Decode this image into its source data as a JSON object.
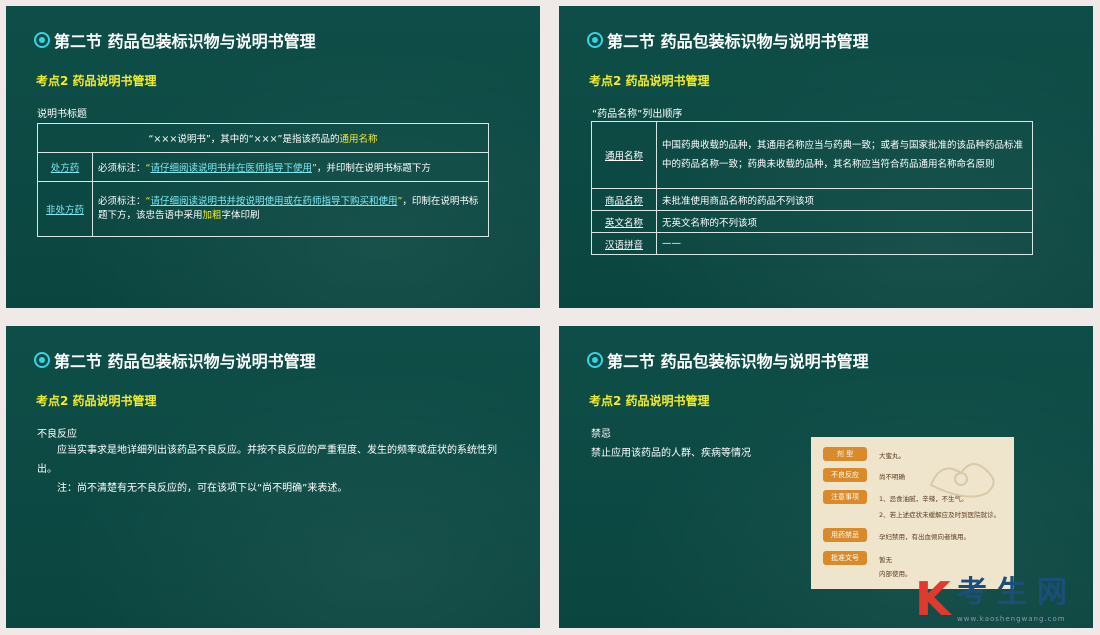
{
  "common": {
    "section_title": "第二节  药品包装标识物与说明书管理",
    "kaodian": "考点2  药品说明书管理"
  },
  "slide1": {
    "subtitle": "说明书标题",
    "header_pre": "“×××说明书”，其中的“×××”是指该药品的",
    "header_highlight": "通用名称",
    "rows": [
      {
        "label": "处方药",
        "pre": "必须标注：",
        "quote_open": "“",
        "link": "请仔细阅读说明书并在医师指导下使用",
        "quote_close": "”",
        "post": "，并印制在说明书标题下方"
      },
      {
        "label": "非处方药",
        "pre": "必须标注：",
        "quote_open": "“",
        "link": "请仔细阅读说明书并按说明使用或在药师指导下购买和使用",
        "quote_close": "”",
        "post": "，印制在说明书标题下方，该忠告语中采用",
        "bold": "加粗",
        "post2": "字体印刷"
      }
    ]
  },
  "slide2": {
    "subtitle": "“药品名称”列出顺序",
    "rows": [
      {
        "label": "通用名称",
        "text": "中国药典收载的品种，其通用名称应当与药典一致；或者与国家批准的该品种药品标准中的药品名称一致；药典未收载的品种，其名称应当符合药品通用名称命名原则"
      },
      {
        "label": "商品名称",
        "text": "未批准使用商品名称的药品不列该项"
      },
      {
        "label": "英文名称",
        "text": "无英文名称的不列该项"
      },
      {
        "label": "汉语拼音",
        "text": "——"
      }
    ]
  },
  "slide3": {
    "subtitle": "不良反应",
    "para1": "应当实事求是地详细列出该药品不良反应。并按不良反应的严重程度、发生的频率或症状的系统性列出。",
    "para2": "注：尚不清楚有无不良反应的，可在该项下以“尚不明确”来表述。"
  },
  "slide4": {
    "subtitle": "禁忌",
    "text": "禁止应用该药品的人群、疾病等情况",
    "photo": {
      "labels": [
        "剂  型",
        "不良反应",
        "注意事项",
        "用药禁忌",
        "批准文号"
      ],
      "texts": [
        "大蜜丸。",
        "尚不明确",
        "1、忌食油腻，辛辣，不生气。",
        "2、若上述症状未缓解应及时到医院就诊。",
        "孕妇禁用，有出血倾向者慎用。",
        "暂无",
        "内部使用。"
      ]
    }
  },
  "logo": {
    "k": "K",
    "word": "考生网",
    "url": "www.kaoshengwang.com"
  }
}
